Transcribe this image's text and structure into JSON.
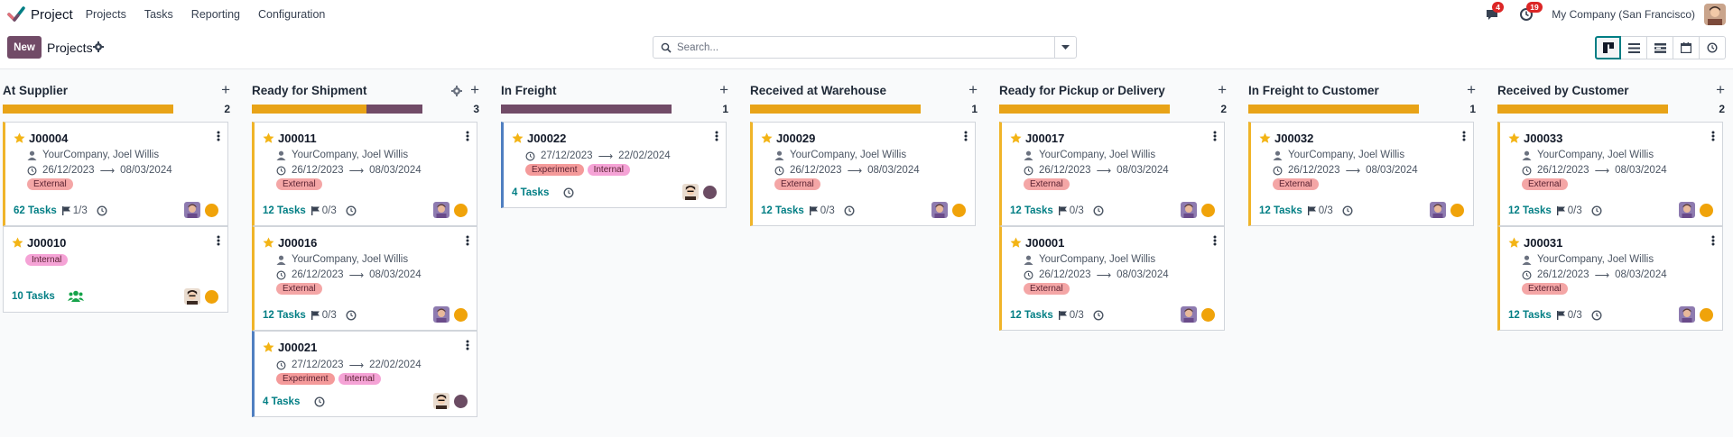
{
  "app": {
    "name": "Project",
    "menu": [
      "Projects",
      "Tasks",
      "Reporting",
      "Configuration"
    ],
    "messages_count": "4",
    "activities_count": "19",
    "company": "My Company (San Francisco)"
  },
  "control": {
    "new_label": "New",
    "breadcrumb": "Projects",
    "search_placeholder": "Search..."
  },
  "colors": {
    "brand": "#714b67",
    "accent": "#017e84",
    "yellow_progress": "#f0a30a",
    "purple_progress": "#714b67",
    "status_orange": "#f0a30a",
    "status_purple": "#6b4c63"
  },
  "columns": [
    {
      "title": "At Supplier",
      "count": "2",
      "progress": [
        {
          "color": "#e8a317",
          "fraction": 1.0
        }
      ],
      "cards": [
        {
          "name": "J00004",
          "customer": "YourCompany, Joel Willis",
          "date_start": "26/12/2023",
          "date_end": "08/03/2024",
          "tags": [
            "External"
          ],
          "tasks": "62 Tasks",
          "milestones": "1/3",
          "status": "orange",
          "variant": "ext"
        },
        {
          "name": "J00010",
          "tags": [
            "Internal"
          ],
          "tasks": "10 Tasks",
          "status": "orange",
          "variant": "plain",
          "group": true
        }
      ]
    },
    {
      "title": "Ready for Shipment",
      "count": "3",
      "progress": [
        {
          "color": "#e8a317",
          "fraction": 0.67
        },
        {
          "color": "#714b67",
          "fraction": 0.33
        }
      ],
      "cards": [
        {
          "name": "J00011",
          "customer": "YourCompany, Joel Willis",
          "date_start": "26/12/2023",
          "date_end": "08/03/2024",
          "tags": [
            "External"
          ],
          "tasks": "12 Tasks",
          "milestones": "0/3",
          "status": "orange",
          "variant": "ext"
        },
        {
          "name": "J00016",
          "customer": "YourCompany, Joel Willis",
          "date_start": "26/12/2023",
          "date_end": "08/03/2024",
          "tags": [
            "External"
          ],
          "tasks": "12 Tasks",
          "milestones": "0/3",
          "status": "orange",
          "variant": "ext"
        },
        {
          "name": "J00021",
          "date_start": "27/12/2023",
          "date_end": "22/02/2024",
          "tags": [
            "Experiment",
            "Internal"
          ],
          "tasks": "4 Tasks",
          "status": "purple",
          "variant": "exp"
        }
      ]
    },
    {
      "title": "In Freight",
      "count": "1",
      "progress": [
        {
          "color": "#714b67",
          "fraction": 1.0
        }
      ],
      "cards": [
        {
          "name": "J00022",
          "date_start": "27/12/2023",
          "date_end": "22/02/2024",
          "tags": [
            "Experiment",
            "Internal"
          ],
          "tasks": "4 Tasks",
          "status": "purple",
          "variant": "exp"
        }
      ]
    },
    {
      "title": "Received at Warehouse",
      "count": "1",
      "progress": [
        {
          "color": "#e8a317",
          "fraction": 1.0
        }
      ],
      "cards": [
        {
          "name": "J00029",
          "customer": "YourCompany, Joel Willis",
          "date_start": "26/12/2023",
          "date_end": "08/03/2024",
          "tags": [
            "External"
          ],
          "tasks": "12 Tasks",
          "milestones": "0/3",
          "status": "orange",
          "variant": "ext"
        }
      ]
    },
    {
      "title": "Ready for Pickup or Delivery",
      "count": "2",
      "progress": [
        {
          "color": "#e8a317",
          "fraction": 1.0
        }
      ],
      "cards": [
        {
          "name": "J00017",
          "customer": "YourCompany, Joel Willis",
          "date_start": "26/12/2023",
          "date_end": "08/03/2024",
          "tags": [
            "External"
          ],
          "tasks": "12 Tasks",
          "milestones": "0/3",
          "status": "orange",
          "variant": "ext"
        },
        {
          "name": "J00001",
          "customer": "YourCompany, Joel Willis",
          "date_start": "26/12/2023",
          "date_end": "08/03/2024",
          "tags": [
            "External"
          ],
          "tasks": "12 Tasks",
          "milestones": "0/3",
          "status": "orange",
          "variant": "ext"
        }
      ]
    },
    {
      "title": "In Freight to Customer",
      "count": "1",
      "progress": [
        {
          "color": "#e8a317",
          "fraction": 1.0
        }
      ],
      "cards": [
        {
          "name": "J00032",
          "customer": "YourCompany, Joel Willis",
          "date_start": "26/12/2023",
          "date_end": "08/03/2024",
          "tags": [
            "External"
          ],
          "tasks": "12 Tasks",
          "milestones": "0/3",
          "status": "orange",
          "variant": "ext"
        }
      ]
    },
    {
      "title": "Received by Customer",
      "count": "2",
      "progress": [
        {
          "color": "#e8a317",
          "fraction": 1.0
        }
      ],
      "cards": [
        {
          "name": "J00033",
          "customer": "YourCompany, Joel Willis",
          "date_start": "26/12/2023",
          "date_end": "08/03/2024",
          "tags": [
            "External"
          ],
          "tasks": "12 Tasks",
          "milestones": "0/3",
          "status": "orange",
          "variant": "ext"
        },
        {
          "name": "J00031",
          "customer": "YourCompany, Joel Willis",
          "date_start": "26/12/2023",
          "date_end": "08/03/2024",
          "tags": [
            "External"
          ],
          "tasks": "12 Tasks",
          "milestones": "0/3",
          "status": "orange",
          "variant": "ext"
        }
      ]
    }
  ]
}
